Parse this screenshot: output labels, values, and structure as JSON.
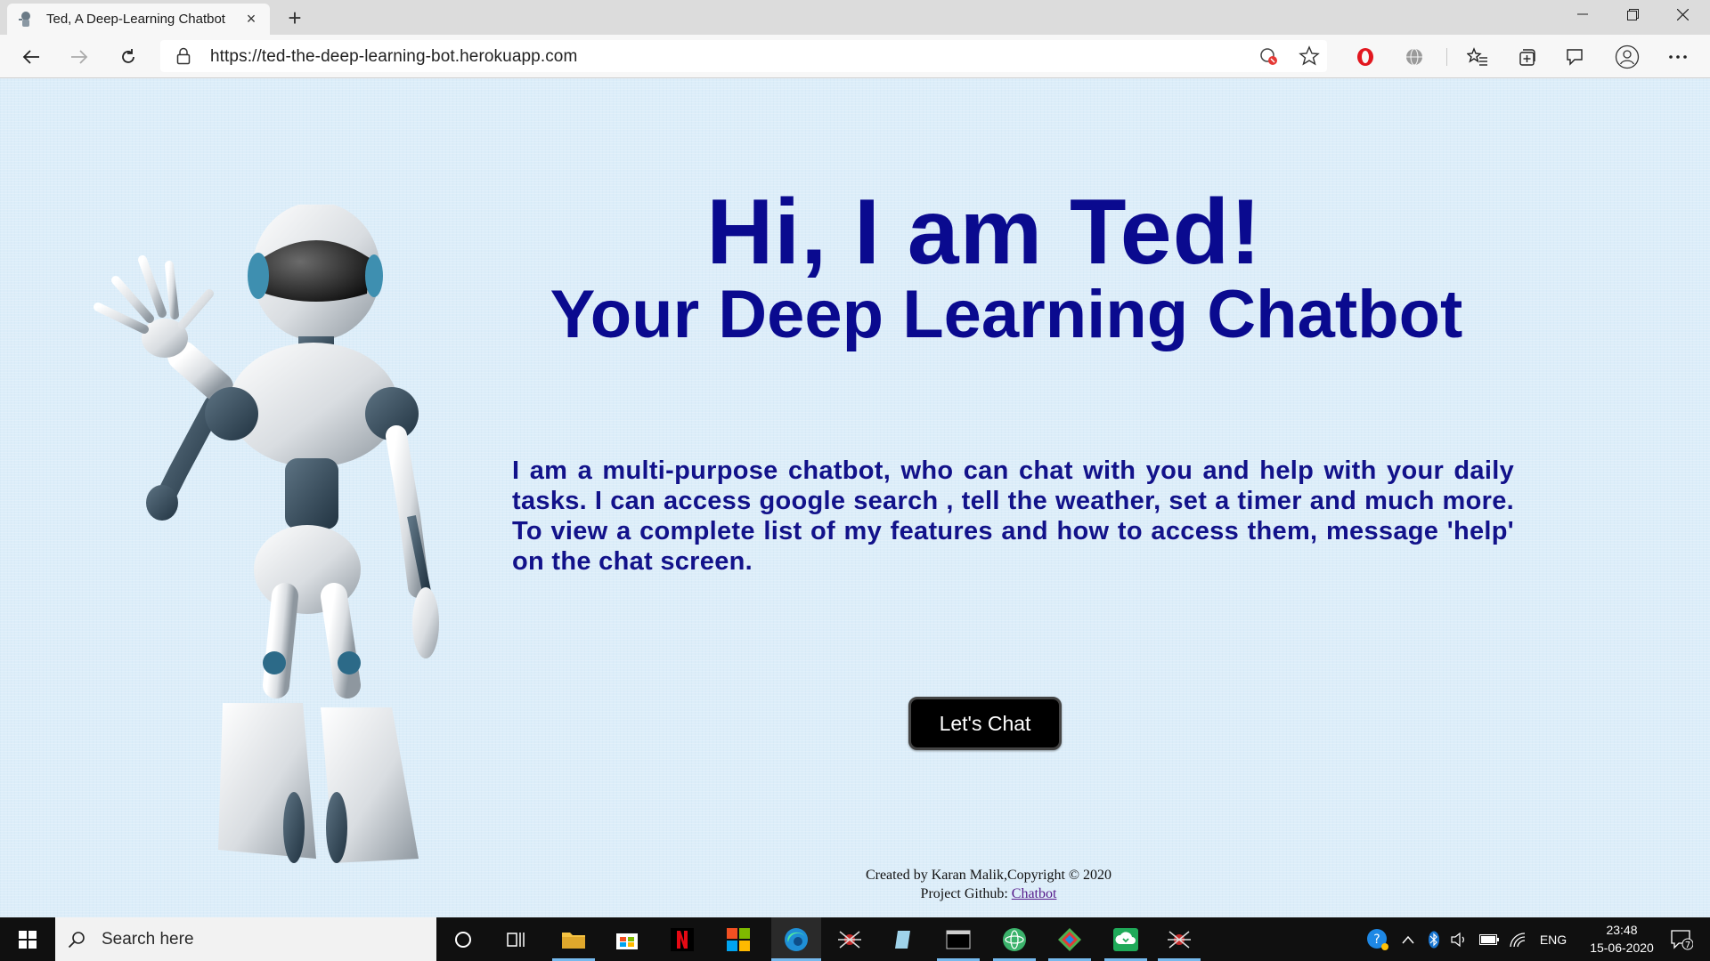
{
  "browser": {
    "tab_title": "Ted, A Deep-Learning Chatbot",
    "tab_close": "×",
    "new_tab": "+",
    "url": "https://ted-the-deep-learning-bot.herokuapp.com"
  },
  "page": {
    "heading": "Hi, I am Ted!",
    "subheading": "Your Deep Learning Chatbot",
    "description": "I am a multi-purpose chatbot, who can chat with you and help with your daily tasks. I can access google search , tell the weather, set a timer and much more. To view a complete list of my features and how to access them, message 'help' on the chat screen.",
    "button_label": "Let's Chat",
    "footer_line1": "Created by Karan Malik,Copyright © 2020",
    "footer_github_prefix": "Project Github: ",
    "footer_github_link": "Chatbot"
  },
  "taskbar": {
    "search_placeholder": "Search here",
    "language": "ENG",
    "time": "23:48",
    "date": "15-06-2020",
    "notification_count": "7"
  },
  "colors": {
    "heading": "#0a0a8f",
    "page_background": "#dcedf9",
    "button": "#000000"
  }
}
